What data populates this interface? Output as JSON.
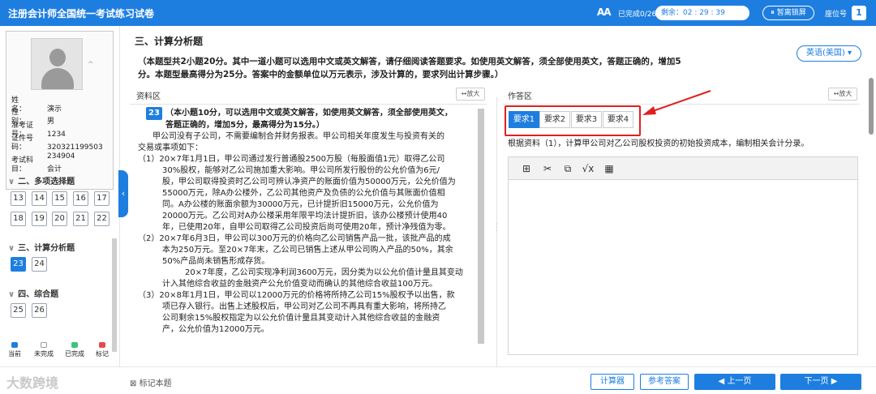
{
  "header": {
    "title": "注册会计师全国统一考试练习试卷",
    "font_icon": "AA",
    "progress": "已完成0/26题",
    "timer_label": "剩余：02 : 29 : 39",
    "lock_label": "暂离锁屏",
    "lock_icon": "pause-icon",
    "seat_label": "座位号",
    "seat_number": "1"
  },
  "candidate": {
    "name_key": "姓　　名：",
    "name": "演示",
    "gender_key": "性　　别：",
    "gender": "男",
    "ticket_key": "准考证号：",
    "ticket": "1234",
    "id_key": "证件号码：",
    "id_line1": "320321199503",
    "id_line2": "234904",
    "subject_key": "考试科目：",
    "subject": "会计"
  },
  "nav": {
    "sections": [
      {
        "label": "二、多项选择题"
      },
      {
        "label": "三、计算分析题"
      },
      {
        "label": "四、综合题"
      }
    ],
    "multi": [
      "13",
      "14",
      "15",
      "16",
      "17",
      "18",
      "19",
      "20",
      "21",
      "22"
    ],
    "calc": [
      "23",
      "24"
    ],
    "comp": [
      "25",
      "26"
    ],
    "legend": [
      "当前",
      "未完成",
      "已完成",
      "标记"
    ],
    "legend_colors": [
      "#1e7ee0",
      "#ffffff",
      "#3cc47c",
      "#e84a4a"
    ]
  },
  "main": {
    "section_title": "三、计算分析题",
    "language": "英语(美国)",
    "intro_line1": "（本题型共2小题20分。其中一道小题可以选用中文或英文解答，请仔细阅读答题要求。如使用英文解答，须全部使用英文，答题正确的，增加5",
    "intro_line2": "分。本题型最高得分为25分。答案中的金额单位以万元表示，涉及计算的，要求列出计算步骤。）",
    "material_title": "资料区",
    "answer_title": "作答区",
    "zoom_label": "放大"
  },
  "material": {
    "qnum": "23",
    "head1": "（本小题10分，可以选用中文或英文解答，如使用英文解答，须全部使用英文，",
    "head2": "答题正确的，增加5分，最高得分为15分。）",
    "p0a": "甲公司没有子公司，不需要编制合并财务报表。甲公司相关年度发生与投资有关的",
    "p0b": "交易或事项如下：",
    "i1a": "（1）20×7年1月1日，甲公司通过发行普通股2500万股（每股面值1元）取得乙公司",
    "i1b": "30%股权，能够对乙公司施加重大影响。甲公司所发行股份的公允价值为6元/",
    "i1c": "股，甲公司取得投资时乙公司可辨认净资产的账面价值为50000万元，公允价值为",
    "i1d": "55000万元，除A办公楼外，乙公司其他资产及负债的公允价值与其账面价值相",
    "i1e": "同。A办公楼的账面余额为30000万元，已计提折旧15000万元，公允价值为",
    "i1f": "20000万元。乙公司对A办公楼采用年限平均法计提折旧，该办公楼预计使用40",
    "i1g": "年，已使用20年，自甲公司取得乙公司投资后尚可使用20年，预计净残值为零。",
    "i2a": "（2）20×7年6月3日，甲公司以300万元的价格向乙公司销售产品一批，该批产品的成",
    "i2b": "本为250万元。至20×7年末，乙公司已销售上述从甲公司购入产品的50%，其余",
    "i2c": "50%产品尚未销售形成存货。",
    "i2d": "20×7年度，乙公司实现净利润3600万元，因分类为以公允价值计量且其变动",
    "i2e": "计入其他综合收益的金融资产公允价值变动而确认的其他综合收益100万元。",
    "i3a": "（3）20×8年1月1日，甲公司以12000万元的价格将所持乙公司15%股权予以出售，款",
    "i3b": "项已存入银行。出售上述股权后，甲公司对乙公司不再具有重大影响，将所持乙",
    "i3c": "公司剩余15%股权指定为以公允价值计量且其变动计入其他综合收益的金融资",
    "i3d": "产，公允价值为12000万元。"
  },
  "answer": {
    "tabs": [
      "要求1",
      "要求2",
      "要求3",
      "要求4"
    ],
    "requirement": "根据资料（1），计算甲公司对乙公司股权投资的初始投资成本，编制相关会计分录。",
    "toolbar_icons": [
      "special-char-icon",
      "cut-icon",
      "copy-icon",
      "formula-icon",
      "table-icon"
    ]
  },
  "footer": {
    "watermark": "大数跨境",
    "mark_label": "标记本题",
    "calculator": "计算器",
    "reference": "参考答案",
    "prev": "上一页",
    "next": "下一页"
  }
}
